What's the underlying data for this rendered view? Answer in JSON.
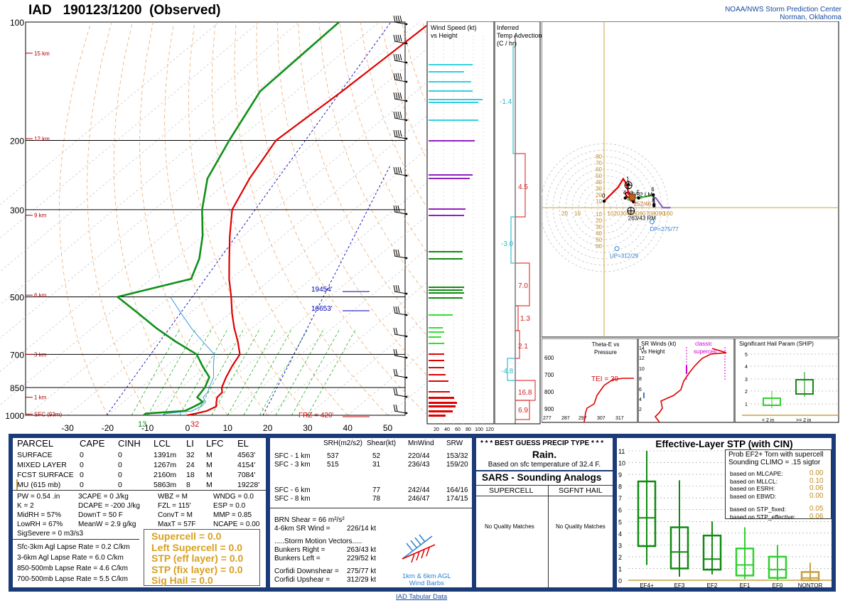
{
  "header": {
    "station": "IAD",
    "time": "190123/1200",
    "status": "(Observed)",
    "agency_line1": "NOAA/NWS Storm Prediction Center",
    "agency_line2": "Norman, Oklahoma"
  },
  "skewt": {
    "pressure_levels": [
      "100",
      "200",
      "300",
      "500",
      "700",
      "850",
      "1000"
    ],
    "temp_ticks": [
      "-30",
      "-20",
      "-10",
      "0",
      "10",
      "20",
      "30",
      "40",
      "50"
    ],
    "height_labels": [
      "15 km",
      "12 km",
      "9 km",
      "6 km",
      "3 km",
      "1 km",
      "SFC (93m)"
    ],
    "labels": {
      "sfc_dewpoint": "13",
      "sfc_temp": "32",
      "frz": "FRZ = 420'",
      "level_19454": "19454'",
      "level_16653": "16653'"
    },
    "colors": {
      "temp": "#e00000",
      "dewpoint": "#10901a",
      "virtual": "#a040a0",
      "wetbulb": "#2090e0"
    },
    "chart_data": {
      "type": "line",
      "xlabel": "",
      "ylabel": "",
      "ylim": [
        1000,
        100
      ],
      "xlim": [
        -30,
        50
      ],
      "series": [
        {
          "name": "Temperature",
          "pressure": [
            1000,
            990,
            975,
            950,
            925,
            900,
            875,
            850,
            800,
            750,
            700,
            650,
            600,
            550,
            500,
            450,
            400,
            350,
            300,
            250,
            200,
            150,
            100
          ],
          "values": [
            0,
            1.5,
            3.5,
            4.5,
            3.2,
            2.0,
            1.8,
            0.2,
            -1.8,
            -3.6,
            -5.2,
            -9.5,
            -14.5,
            -19.5,
            -24.6,
            -30.5,
            -36.5,
            -43.2,
            -50.5,
            -55.5,
            -60.3,
            -58.5,
            -57.0
          ]
        },
        {
          "name": "Dewpoint",
          "pressure": [
            1000,
            990,
            975,
            950,
            925,
            900,
            875,
            850,
            800,
            750,
            700,
            650,
            600,
            550,
            500,
            450,
            400,
            350,
            300,
            250,
            200,
            150,
            100
          ],
          "values": [
            -11,
            -11,
            -2,
            -1,
            -0.2,
            -3,
            -3.5,
            -4,
            -6,
            -11,
            -16,
            -25,
            -34,
            -43,
            -53,
            -40,
            -44,
            -50,
            -58,
            -66,
            -72,
            -79,
            -80
          ]
        }
      ]
    }
  },
  "wind_profile": {
    "title_line1": "Wind Speed (kt)",
    "title_line2": "vs Height",
    "ticks": [
      "20",
      "40",
      "60",
      "80",
      "100",
      "120"
    ]
  },
  "temp_advection": {
    "title_line1": "Inferred",
    "title_line2": "Temp Advection",
    "title_line3": "(C / hr)",
    "values": [
      "-1.4",
      "4.5",
      "-3.0",
      "7.0",
      "1.3",
      "2.1",
      "-4.8",
      "16.8",
      "6.9"
    ]
  },
  "hodograph": {
    "rings": [
      "10",
      "20",
      "30",
      "40",
      "50",
      "60",
      "70",
      "80",
      "90",
      "100"
    ],
    "y_ticks": [
      "80",
      "70",
      "60",
      "50",
      "40",
      "30",
      "20",
      "10",
      "10",
      "20",
      "30",
      "40",
      "50",
      "60"
    ],
    "markers": {
      "lm": "229/52 LM",
      "mean": "252/46",
      "rm": "263/43 RM",
      "dp": "DP=275/77",
      "up": "UP=312/29"
    },
    "height_marks": [
      "0",
      "1",
      "2",
      "3",
      "4",
      "5",
      "6",
      "7",
      "8"
    ]
  },
  "theta_e": {
    "title_line1": "Theta-E vs",
    "title_line2": "Pressure",
    "tei": "TEI = 39",
    "y_ticks": [
      "600",
      "700",
      "800",
      "900"
    ],
    "x_ticks": [
      "277",
      "287",
      "297",
      "307",
      "317"
    ]
  },
  "sr_winds": {
    "title_line1": "SR Winds (kt)",
    "title_line2": "vs Height",
    "label_line1": "classic",
    "label_line2": "supercell",
    "y_ticks": [
      "14",
      "12",
      "10",
      "8",
      "6",
      "4",
      "2"
    ]
  },
  "ship": {
    "title": "Significant Hail Param (SHIP)",
    "y_ticks": [
      "5",
      "4",
      "3",
      "2",
      "1"
    ],
    "x_left": "< 2 in",
    "x_right": ">= 2 in"
  },
  "parcel_table": {
    "headers": [
      "PARCEL",
      "CAPE",
      "CINH",
      "LCL",
      "LI",
      "LFC",
      "EL"
    ],
    "rows": [
      [
        "SURFACE",
        "0",
        "0",
        "1391m",
        "32",
        "M",
        "4563'"
      ],
      [
        "MIXED LAYER",
        "0",
        "0",
        "1267m",
        "24",
        "M",
        "4154'"
      ],
      [
        "FCST SURFACE",
        "0",
        "0",
        "2160m",
        "18",
        "M",
        "7084'"
      ],
      [
        "MU  (615 mb)",
        "0",
        "0",
        "5863m",
        "8",
        "M",
        "19228'"
      ]
    ],
    "indices_col1": [
      "PW = 0.54 .in",
      "K = 2",
      "MidRH = 57%",
      "LowRH = 67%",
      "SigSevere = 0 m3/s3"
    ],
    "indices_col2": [
      "3CAPE = 0 J/kg",
      "DCAPE = -200 J/kg",
      "DownT = 50 F",
      "MeanW = 2.9 g/kg"
    ],
    "indices_col3": [
      "WBZ = M",
      "FZL = 115'",
      "ConvT = M",
      "MaxT = 57F"
    ],
    "indices_col4": [
      "WNDG = 0.0",
      "ESP = 0.0",
      "MMP = 0.85",
      "NCAPE = 0.00"
    ],
    "lapse_rates": [
      "Sfc-3km Agl Lapse Rate =  0.2 C/km",
      "3-6km Agl Lapse Rate =  6.0 C/km",
      "850-500mb Lapse Rate =  4.6 C/km",
      "700-500mb Lapse Rate =  5.5 C/km"
    ],
    "params": [
      "Supercell = 0.0",
      "Left Supercell = 0.0",
      "STP (eff layer) = 0.0",
      "STP (fix layer) = 0.0",
      "Sig Hail = 0.0"
    ]
  },
  "kinematics": {
    "headers": [
      "SRH(m2/s2)",
      "Shear(kt)",
      "MnWind",
      "SRW"
    ],
    "rows": [
      [
        "SFC - 1 km",
        "537",
        "52",
        "220/44",
        "153/32"
      ],
      [
        "SFC - 3 km",
        "515",
        "31",
        "236/43",
        "159/20"
      ],
      [
        "SFC - 6 km",
        "",
        "77",
        "242/44",
        "164/16"
      ],
      [
        "SFC - 8 km",
        "",
        "78",
        "246/47",
        "174/15"
      ]
    ],
    "brn_shear": "BRN Shear =  66 m²/s²",
    "sr_wind": "4-6km SR Wind =",
    "sr_wind_val": "226/14 kt",
    "motion_title": ".....Storm Motion Vectors.....",
    "motion_rows": [
      [
        "Bunkers Right =",
        "263/43 kt"
      ],
      [
        "Bunkers Left =",
        "229/52 kt"
      ],
      [
        "Corfidi Downshear =",
        "275/77 kt"
      ],
      [
        "Corfidi Upshear =",
        "312/29 kt"
      ]
    ],
    "inset_line1": "1km & 6km AGL",
    "inset_line2": "Wind Barbs"
  },
  "precip": {
    "title": "* * * BEST GUESS PRECIP TYPE * * *",
    "type": "Rain.",
    "note": "Based on sfc temperature of 32.4 F."
  },
  "sars": {
    "title": "SARS - Sounding Analogs",
    "col1": "SUPERCELL",
    "col2": "SGFNT HAIL",
    "col1_body": "No Quality Matches",
    "col2_body": "No Quality Matches"
  },
  "stp_box": {
    "title": "Effective-Layer STP (with CIN)",
    "prob_line1": "Prob EF2+ Torn with supercell",
    "prob_line2": "Sounding CLIMO = .15 sigtor",
    "based": [
      [
        "based on MLCAPE:",
        "0.00"
      ],
      [
        "based on MLLCL:",
        "0.10"
      ],
      [
        "based on ESRH:",
        "0.06"
      ],
      [
        "based on EBWD:",
        "0.00"
      ],
      [
        "based on STP_fixed:",
        "0.05"
      ],
      [
        "based on STP_effective:",
        "0.06"
      ]
    ],
    "y_ticks": [
      "11",
      "10",
      "9",
      "8",
      "7",
      "6",
      "5",
      "4",
      "3",
      "2",
      "1",
      "0"
    ],
    "categories": [
      "EF4+",
      "EF3",
      "EF2",
      "EF1",
      "EF0",
      "NONTOR"
    ],
    "chart_data": {
      "type": "box",
      "categories": [
        "EF4+",
        "EF3",
        "EF2",
        "EF1",
        "EF0",
        "NONTOR"
      ],
      "whisker_low": [
        1.3,
        0.3,
        0.5,
        0.1,
        0.0,
        0.0
      ],
      "q1": [
        2.9,
        1.0,
        0.9,
        0.4,
        0.2,
        0.0
      ],
      "median": [
        5.3,
        2.4,
        1.8,
        1.3,
        0.9,
        0.2
      ],
      "q3": [
        8.4,
        4.5,
        3.8,
        2.7,
        2.0,
        0.7
      ],
      "whisker_high": [
        11.0,
        8.5,
        5.0,
        4.5,
        3.0,
        1.5
      ]
    }
  },
  "footer": {
    "link": "IAD Tabular Data"
  }
}
